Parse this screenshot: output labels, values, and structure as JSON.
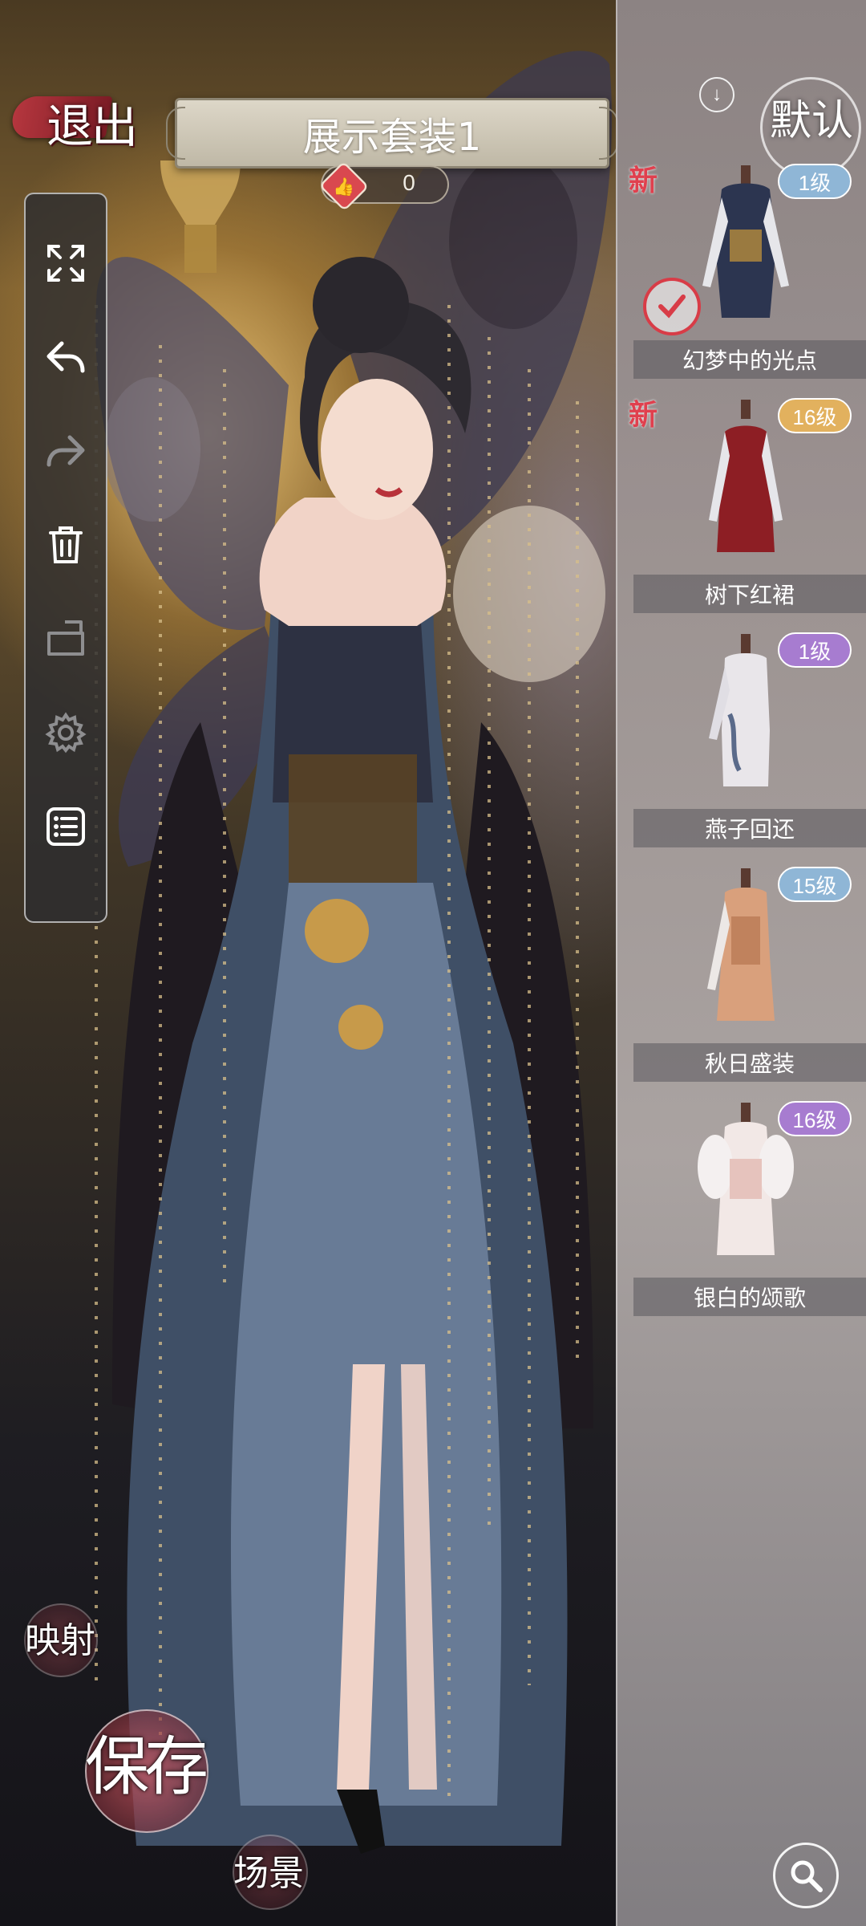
{
  "header": {
    "exit_label": "退出",
    "outfit_title": "展示套装1",
    "like_count": "0"
  },
  "toolbar": {
    "items": [
      {
        "icon": "expand-icon"
      },
      {
        "icon": "undo-icon"
      },
      {
        "icon": "redo-icon"
      },
      {
        "icon": "trash-icon"
      },
      {
        "icon": "folder-icon"
      },
      {
        "icon": "gear-icon"
      },
      {
        "icon": "list-icon"
      }
    ]
  },
  "sidebar": {
    "sort_label": "默认",
    "items": [
      {
        "name": "幻梦中的光点",
        "level": "1级",
        "badge_color": "#8fb6d6",
        "is_new": true,
        "new_label": "新",
        "selected": true
      },
      {
        "name": "树下红裙",
        "level": "16级",
        "badge_color": "#e2b15e",
        "is_new": true,
        "new_label": "新",
        "selected": false
      },
      {
        "name": "燕子回还",
        "level": "1级",
        "badge_color": "#a77cd0",
        "is_new": false,
        "selected": false
      },
      {
        "name": "秋日盛装",
        "level": "15级",
        "badge_color": "#8fb6d6",
        "is_new": false,
        "selected": false
      },
      {
        "name": "银白的颂歌",
        "level": "16级",
        "badge_color": "#a77cd0",
        "is_new": false,
        "selected": false
      }
    ]
  },
  "bottom_actions": {
    "map_label": "映射",
    "save_label": "保存",
    "scene_label": "场景"
  },
  "colors": {
    "accent_red": "#d9484f",
    "panel_bg": "#aaa2a0"
  }
}
